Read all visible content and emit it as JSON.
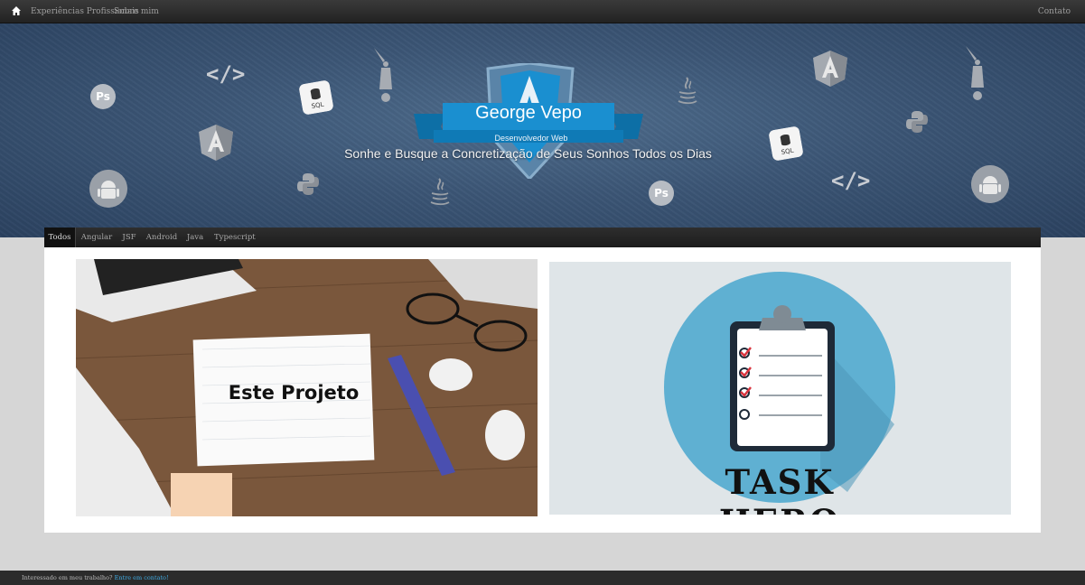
{
  "navbar": {
    "home_icon": "home-icon",
    "links": [
      "Experiências Profissionais",
      "Sobre mim"
    ],
    "contact": "Contato"
  },
  "hero": {
    "name": "George Vepo",
    "role": "Desenvolvedor Web",
    "motto": "Sonhe e Busque a Concretização de Seus Sonhos Todos os Dias",
    "decorations": [
      "photoshop-icon",
      "code-icon",
      "sql-icon",
      "angular-icon",
      "python-icon",
      "java-icon",
      "android-icon",
      "statue-icon"
    ],
    "ps_label": "Ps",
    "code_label": "</>",
    "sql_label": "SQL",
    "accent": "#1a8fd0"
  },
  "filters": {
    "active": "Todos",
    "items": [
      "Todos",
      "Angular",
      "JSF",
      "Android",
      "Java",
      "Typescript"
    ]
  },
  "projects": [
    {
      "caption": "Este Projeto"
    },
    {
      "caption": "TASK HERO"
    }
  ],
  "footer": {
    "text": "Interessado em meu trabalho?",
    "link": "Entre em contato!"
  }
}
